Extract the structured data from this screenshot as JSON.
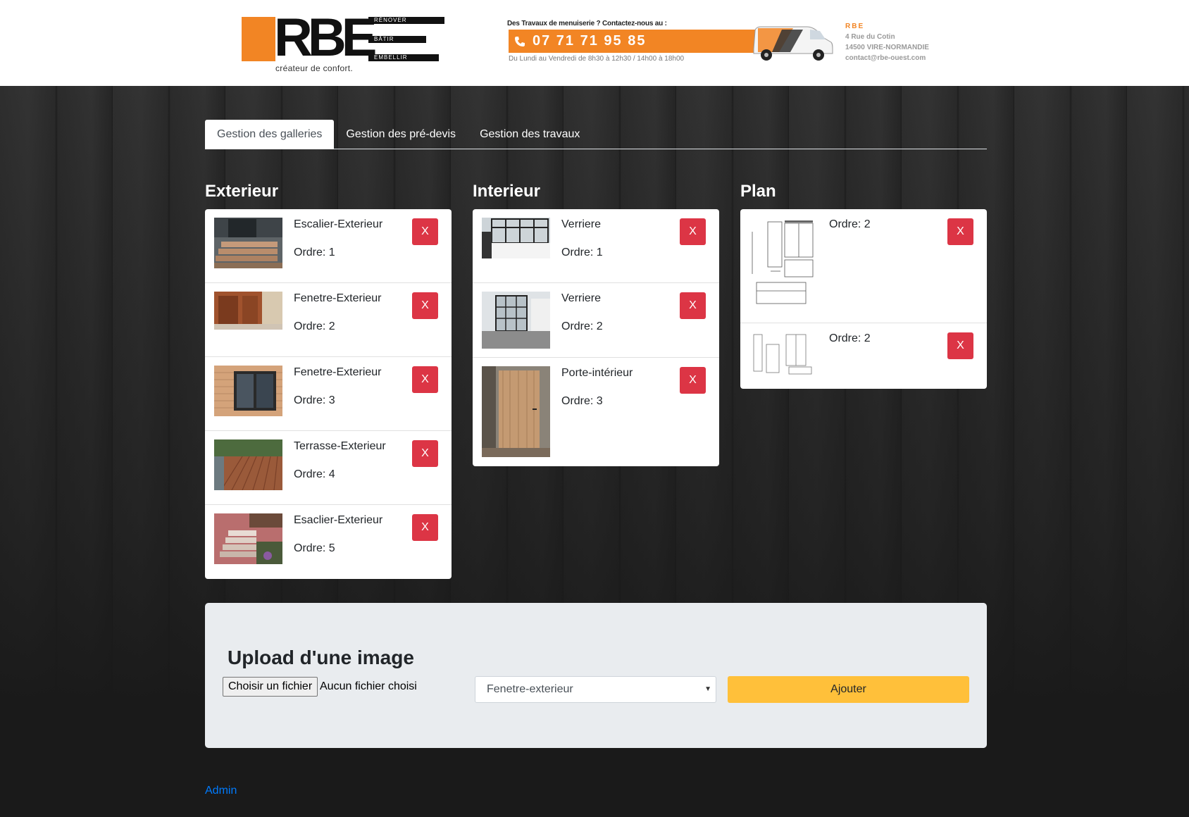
{
  "header": {
    "logo": {
      "letters": "RBE",
      "bars": [
        "RÉNOVER",
        "BÂTIR",
        "EMBELLIR"
      ],
      "tagline": "créateur de confort."
    },
    "contact": {
      "intro": "Des Travaux de menuiserie ? Contactez-nous au :",
      "phone": "07 71 71 95 85",
      "hours": "Du Lundi au Vendredi de 8h30 à 12h30 / 14h00 à 18h00"
    },
    "address": {
      "company": "RBE",
      "street": "4 Rue du Cotin",
      "city": "14500 VIRE-NORMANDIE",
      "email": "contact@rbe-ouest.com"
    },
    "colors": {
      "brand_orange": "#f28524"
    }
  },
  "tabs": [
    {
      "label": "Gestion des galleries",
      "active": true
    },
    {
      "label": "Gestion des pré-devis",
      "active": false
    },
    {
      "label": "Gestion des travaux",
      "active": false
    }
  ],
  "columns": {
    "exterieur": {
      "title": "Exterieur",
      "items": [
        {
          "title": "Escalier-Exterieur",
          "order": "Ordre: 1",
          "delete_label": "X"
        },
        {
          "title": "Fenetre-Exterieur",
          "order": "Ordre: 2",
          "delete_label": "X"
        },
        {
          "title": "Fenetre-Exterieur",
          "order": "Ordre: 3",
          "delete_label": "X"
        },
        {
          "title": "Terrasse-Exterieur",
          "order": "Ordre: 4",
          "delete_label": "X"
        },
        {
          "title": "Esaclier-Exterieur",
          "order": "Ordre: 5",
          "delete_label": "X"
        }
      ]
    },
    "interieur": {
      "title": "Interieur",
      "items": [
        {
          "title": "Verriere",
          "order": "Ordre: 1",
          "delete_label": "X"
        },
        {
          "title": "Verriere",
          "order": "Ordre: 2",
          "delete_label": "X"
        },
        {
          "title": "Porte-intérieur",
          "order": "Ordre: 3",
          "delete_label": "X"
        }
      ]
    },
    "plan": {
      "title": "Plan",
      "items": [
        {
          "title": "",
          "order": "Ordre: 2",
          "delete_label": "X"
        },
        {
          "title": "",
          "order": "Ordre: 2",
          "delete_label": "X"
        }
      ]
    }
  },
  "upload": {
    "title": "Upload d'une image",
    "file_button": "Choisir un fichier",
    "file_status": "Aucun fichier choisi",
    "category_selected": "Fenetre-exterieur",
    "add_button": "Ajouter"
  },
  "footer": {
    "admin_link": "Admin"
  }
}
